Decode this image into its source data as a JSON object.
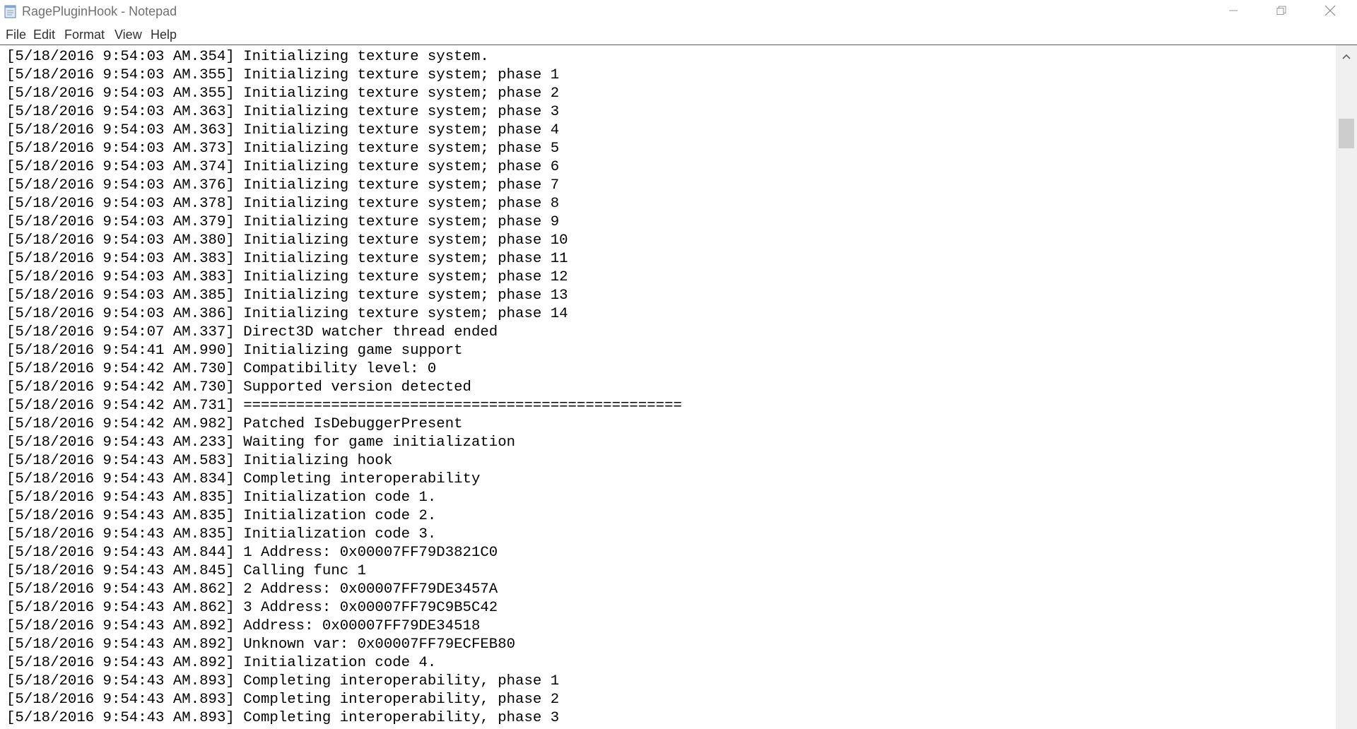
{
  "window": {
    "title": "RagePluginHook - Notepad",
    "icon": "notepad-icon",
    "controls": [
      "minimize-icon",
      "restore-icon",
      "close-icon"
    ]
  },
  "menu": {
    "items": [
      "File",
      "Edit",
      "Format",
      "View",
      "Help"
    ]
  },
  "editor": {
    "lines": [
      "[5/18/2016 9:54:03 AM.354] Initializing texture system.",
      "[5/18/2016 9:54:03 AM.355] Initializing texture system; phase 1",
      "[5/18/2016 9:54:03 AM.355] Initializing texture system; phase 2",
      "[5/18/2016 9:54:03 AM.363] Initializing texture system; phase 3",
      "[5/18/2016 9:54:03 AM.363] Initializing texture system; phase 4",
      "[5/18/2016 9:54:03 AM.373] Initializing texture system; phase 5",
      "[5/18/2016 9:54:03 AM.374] Initializing texture system; phase 6",
      "[5/18/2016 9:54:03 AM.376] Initializing texture system; phase 7",
      "[5/18/2016 9:54:03 AM.378] Initializing texture system; phase 8",
      "[5/18/2016 9:54:03 AM.379] Initializing texture system; phase 9",
      "[5/18/2016 9:54:03 AM.380] Initializing texture system; phase 10",
      "[5/18/2016 9:54:03 AM.383] Initializing texture system; phase 11",
      "[5/18/2016 9:54:03 AM.383] Initializing texture system; phase 12",
      "[5/18/2016 9:54:03 AM.385] Initializing texture system; phase 13",
      "[5/18/2016 9:54:03 AM.386] Initializing texture system; phase 14",
      "[5/18/2016 9:54:07 AM.337] Direct3D watcher thread ended",
      "[5/18/2016 9:54:41 AM.990] Initializing game support",
      "[5/18/2016 9:54:42 AM.730] Compatibility level: 0",
      "[5/18/2016 9:54:42 AM.730] Supported version detected",
      "[5/18/2016 9:54:42 AM.731] ==================================================",
      "[5/18/2016 9:54:42 AM.982] Patched IsDebuggerPresent",
      "[5/18/2016 9:54:43 AM.233] Waiting for game initialization",
      "[5/18/2016 9:54:43 AM.583] Initializing hook",
      "[5/18/2016 9:54:43 AM.834] Completing interoperability",
      "[5/18/2016 9:54:43 AM.835] Initialization code 1.",
      "[5/18/2016 9:54:43 AM.835] Initialization code 2.",
      "[5/18/2016 9:54:43 AM.835] Initialization code 3.",
      "[5/18/2016 9:54:43 AM.844] 1 Address: 0x00007FF79D3821C0",
      "[5/18/2016 9:54:43 AM.845] Calling func 1",
      "[5/18/2016 9:54:43 AM.862] 2 Address: 0x00007FF79DE3457A",
      "[5/18/2016 9:54:43 AM.862] 3 Address: 0x00007FF79C9B5C42",
      "[5/18/2016 9:54:43 AM.892] Address: 0x00007FF79DE34518",
      "[5/18/2016 9:54:43 AM.892] Unknown var: 0x00007FF79ECFEB80",
      "[5/18/2016 9:54:43 AM.892] Initialization code 4.",
      "[5/18/2016 9:54:43 AM.893] Completing interoperability, phase 1",
      "[5/18/2016 9:54:43 AM.893] Completing interoperability, phase 2",
      "[5/18/2016 9:54:43 AM.893] Completing interoperability, phase 3"
    ]
  },
  "scrollbar": {
    "up_icon": "chevron-up-icon"
  }
}
